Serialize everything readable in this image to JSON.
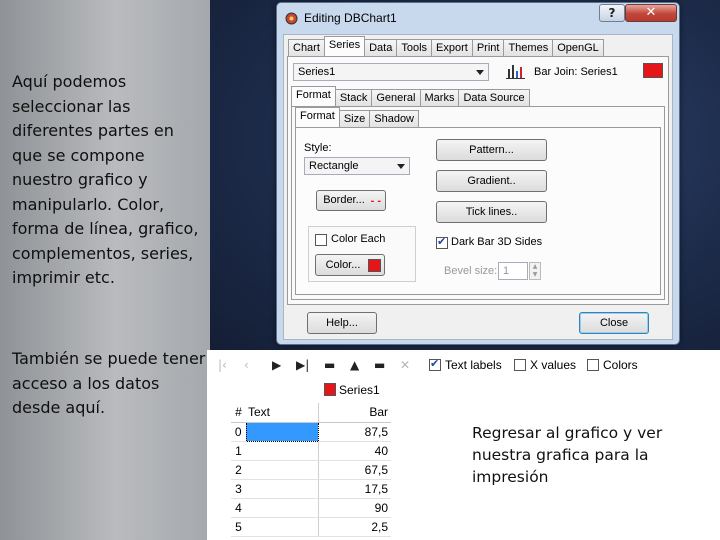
{
  "slide": {
    "left_text_1": "Aquí podemos seleccionar las diferentes partes en que se compone nuestro grafico y manipularlo.  Color, forma de línea, grafico, complementos, series, imprimir etc.",
    "left_text_2": "También se puede tener acceso a los datos desde aquí.",
    "return_text": "Regresar al grafico y ver nuestra grafica para la impresión"
  },
  "dialog": {
    "title": "Editing DBChart1",
    "help_symbol": "?",
    "close_symbol": "✕",
    "main_tabs": [
      "Chart",
      "Series",
      "Data",
      "Tools",
      "Export",
      "Print",
      "Themes",
      "OpenGL"
    ],
    "active_main_tab": "Series",
    "series_combo": "Series1",
    "bar_join_label": "Bar Join: Series1",
    "series_tabs": [
      "Format",
      "Stack",
      "General",
      "Marks",
      "Data Source"
    ],
    "active_series_tab": "Format",
    "format_tabs": [
      "Format",
      "Size",
      "Shadow"
    ],
    "style_label": "Style:",
    "style_value": "Rectangle",
    "border_button": "Border...",
    "color_each_label": "Color Each",
    "color_each_checked": false,
    "color_button": "Color...",
    "pattern_button": "Pattern...",
    "gradient_button": "Gradient..",
    "tick_lines_button": "Tick lines..",
    "dark_bar_label": "Dark Bar 3D Sides",
    "dark_bar_checked": true,
    "bevel_label": "Bevel size:",
    "bevel_value": "1",
    "help_button": "Help...",
    "close_button": "Close",
    "series_color": "#e5161a"
  },
  "data_grid": {
    "toolbar": {
      "text_labels": "Text labels",
      "text_labels_checked": true,
      "x_values": "X values",
      "x_values_checked": false,
      "colors": "Colors",
      "colors_checked": false
    },
    "series_header": "Series1",
    "col_index": "#",
    "col_text": "Text",
    "col_bar": "Bar",
    "rows": [
      {
        "index": "0",
        "text": "",
        "bar": "87,5"
      },
      {
        "index": "1",
        "text": "",
        "bar": "40"
      },
      {
        "index": "2",
        "text": "",
        "bar": "67,5"
      },
      {
        "index": "3",
        "text": "",
        "bar": "17,5"
      },
      {
        "index": "4",
        "text": "",
        "bar": "90"
      },
      {
        "index": "5",
        "text": "",
        "bar": "2,5"
      }
    ]
  }
}
